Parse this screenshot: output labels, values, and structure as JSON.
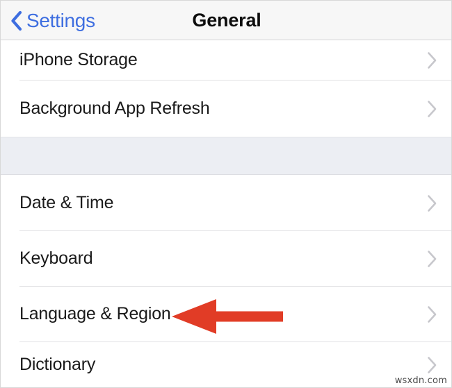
{
  "navbar": {
    "back_label": "Settings",
    "back_icon": "chevron-left-icon",
    "title": "General",
    "tint_color": "#3e6ee0",
    "background_color": "#f7f7f7"
  },
  "list": {
    "disclosure_icon": "chevron-right-icon",
    "disclosure_color": "#c7c7cc",
    "sections": [
      {
        "rows": [
          {
            "label": "iPhone Storage"
          },
          {
            "label": "Background App Refresh"
          }
        ]
      },
      {
        "rows": [
          {
            "label": "Date & Time"
          },
          {
            "label": "Keyboard"
          },
          {
            "label": "Language & Region"
          },
          {
            "label": "Dictionary"
          }
        ]
      }
    ]
  },
  "annotation": {
    "type": "arrow-left",
    "color": "#e13c26",
    "points_at": "Language & Region"
  },
  "watermark": {
    "text": "wsxdn.com"
  }
}
